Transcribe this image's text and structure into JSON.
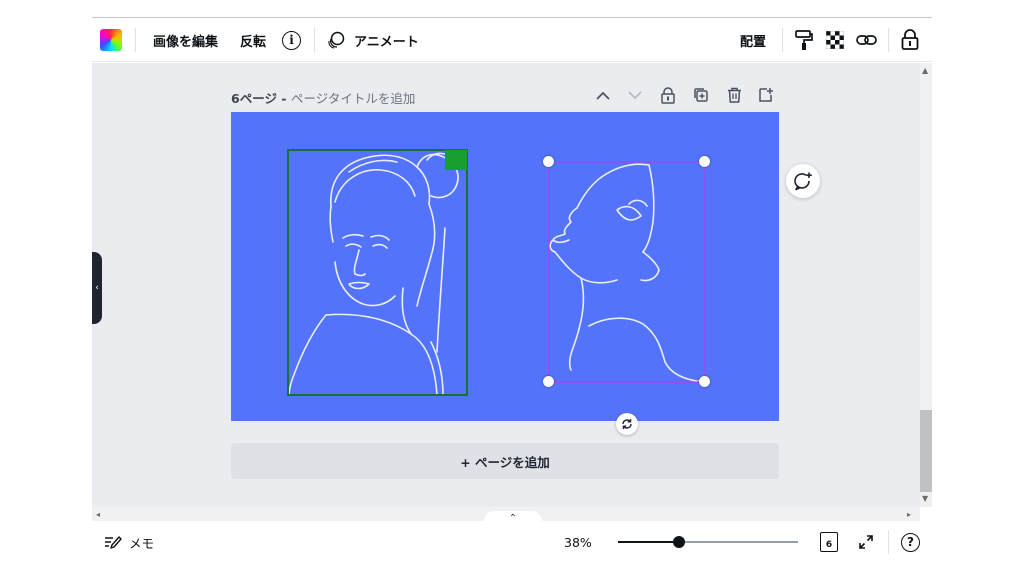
{
  "toolbar": {
    "color_icon": "color-palette-icon",
    "edit_image_label": "画像を編集",
    "flip_label": "反転",
    "info_icon_glyph": "i",
    "animate_label": "アニメート",
    "position_label": "配置",
    "icons": [
      "paint-roller-icon",
      "transparency-icon",
      "link-icon",
      "lock-icon"
    ]
  },
  "page_header": {
    "page_number": "6ページ",
    "separator": " - ",
    "title_placeholder": "ページタイトルを追加"
  },
  "canvas": {
    "background_color": "#5473fb",
    "left_image": "line-art-woman-portrait",
    "right_image": "line-art-woman-profile"
  },
  "add_page_label": "+ ページを追加",
  "bottom_bar": {
    "notes_label": "メモ",
    "zoom_value": "38%",
    "zoom_fraction": 0.34,
    "page_count": "6",
    "help_glyph": "?"
  },
  "collapse_glyph": "⌃",
  "left_tab_glyph": "‹"
}
